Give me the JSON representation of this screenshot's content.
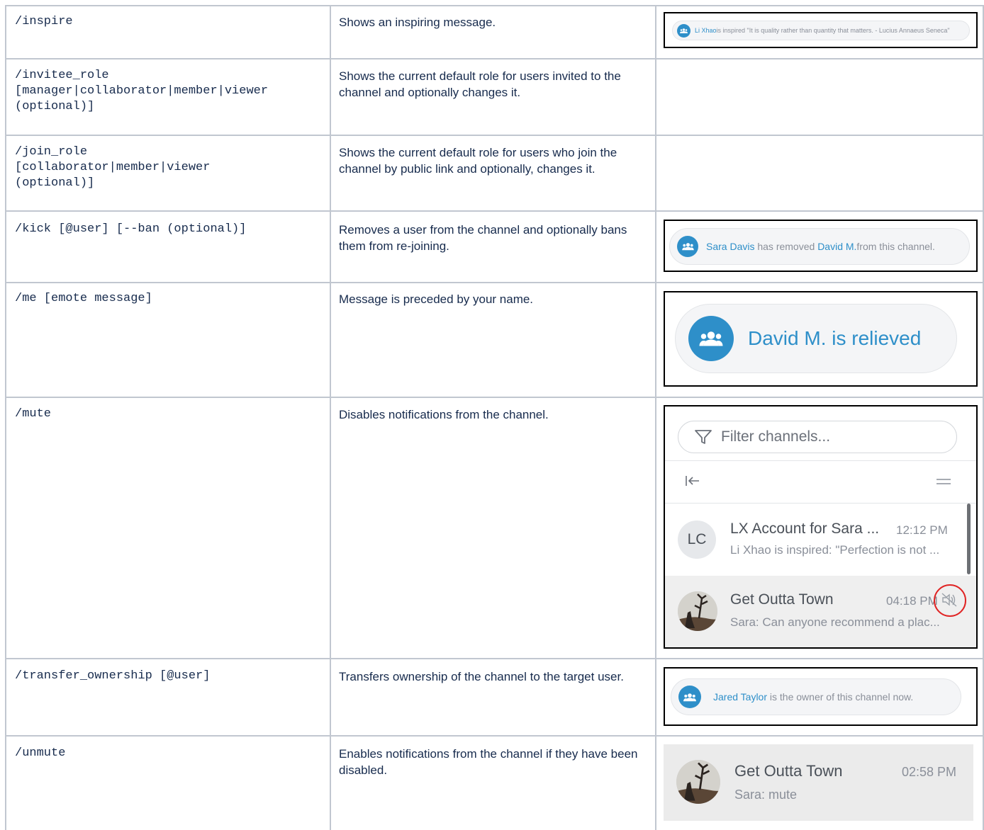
{
  "rows": [
    {
      "command": "/inspire",
      "description": "Shows an inspiring message.",
      "example": {
        "user": "Li Xhao",
        "text": " is inspired \"It is quality rather than quantity that matters. - Lucius Annaeus Seneca\""
      }
    },
    {
      "command": "/invitee_role\n[manager|collaborator|member|viewer\n(optional)]",
      "description": "Shows the current default role for users invited to the channel and optionally changes it."
    },
    {
      "command": "/join_role\n[collaborator|member|viewer\n(optional)]",
      "description": "Shows the current default role for users who join the channel by public link and optionally, changes it."
    },
    {
      "command": "/kick [@user] [--ban (optional)]",
      "description": "Removes a user from the channel and optionally bans them from re-joining.",
      "example": {
        "actor": "Sara Davis",
        "text1": " has removed ",
        "target": "David M.",
        "text2": " from this channel."
      }
    },
    {
      "command": "/me [emote message]",
      "description": "Message is preceded by your name.",
      "example": {
        "text": "David M. is relieved"
      }
    },
    {
      "command": "/mute",
      "description": "Disables notifications from the channel.",
      "example": {
        "filter_placeholder": "Filter channels...",
        "channels": [
          {
            "initials": "LC",
            "title": "LX Account for Sara ...",
            "time": "12:12 PM",
            "preview": "Li Xhao is inspired: \"Perfection is not ..."
          },
          {
            "title": "Get Outta Town",
            "time": "04:18 PM",
            "preview": "Sara: Can anyone recommend a plac...",
            "muted": true
          }
        ]
      }
    },
    {
      "command": "/transfer_ownership [@user]",
      "description": "Transfers ownership of the channel to the target user.",
      "example": {
        "user": "Jared Taylor",
        "text": " is the owner of this channel now."
      }
    },
    {
      "command": "/unmute",
      "description": "Enables notifications from the channel if they have been disabled.",
      "example": {
        "title": "Get Outta Town",
        "time": "02:58 PM",
        "preview": "Sara: mute"
      }
    }
  ],
  "colors": {
    "link": "#2e8fc9",
    "border": "#c1c7d0",
    "mute_highlight": "#e02424"
  },
  "icons": [
    "group-icon",
    "filter-icon",
    "collapse-left-icon",
    "menu-icon",
    "mute-icon"
  ]
}
